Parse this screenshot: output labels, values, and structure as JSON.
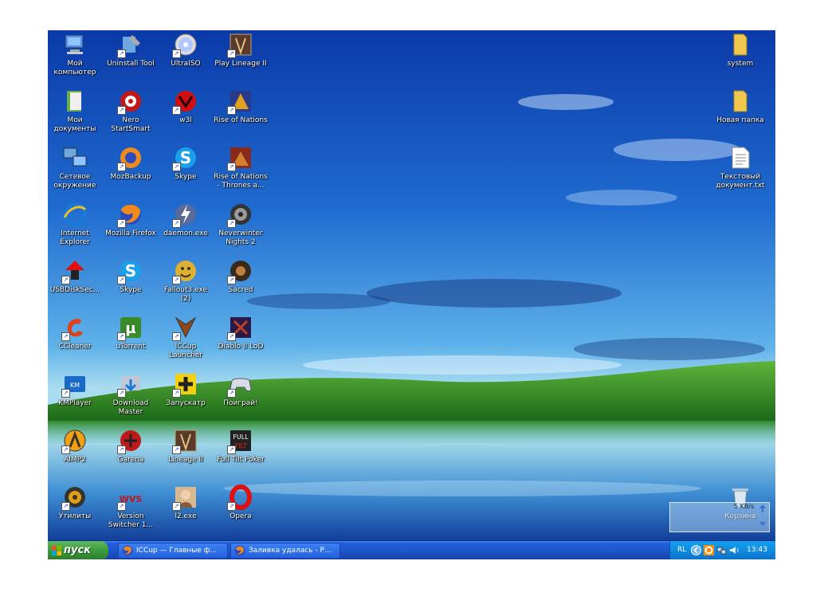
{
  "desktop": {
    "icons": [
      {
        "label": "Мой компьютер",
        "icon": "computer-icon"
      },
      {
        "label": "Uninstall Tool",
        "icon": "uninstall-icon"
      },
      {
        "label": "UltraISO",
        "icon": "disc-icon"
      },
      {
        "label": "Play Lineage II",
        "icon": "lineage-icon"
      },
      {
        "label": "Мои документы",
        "icon": "documents-icon"
      },
      {
        "label": "Nero StartSmart",
        "icon": "nero-icon"
      },
      {
        "label": "w3l",
        "icon": "w3l-icon"
      },
      {
        "label": "Rise of Nations",
        "icon": "rise-of-nations-icon"
      },
      {
        "label": "Сетевое окружение",
        "icon": "network-icon"
      },
      {
        "label": "MozBackup",
        "icon": "mozbackup-icon"
      },
      {
        "label": "Skype",
        "icon": "skype-icon"
      },
      {
        "label": "Rise of Nations - Thrones a...",
        "icon": "thrones-icon"
      },
      {
        "label": "Internet Explorer",
        "icon": "ie-icon"
      },
      {
        "label": "Mozilla Firefox",
        "icon": "firefox-icon"
      },
      {
        "label": "daemon.exe",
        "icon": "daemon-icon"
      },
      {
        "label": "Neverwinter Nights 2",
        "icon": "neverwinter-icon"
      },
      {
        "label": "USBDiskSec...",
        "icon": "usb-icon"
      },
      {
        "label": "Skype",
        "icon": "skype-icon"
      },
      {
        "label": "Fallout3.exe (2)",
        "icon": "fallout-icon"
      },
      {
        "label": "Sacred",
        "icon": "sacred-icon"
      },
      {
        "label": "CCleaner",
        "icon": "ccleaner-icon"
      },
      {
        "label": "uTorrent",
        "icon": "utorrent-icon"
      },
      {
        "label": "ICCup Launcher",
        "icon": "iccup-icon"
      },
      {
        "label": "Diablo II LoD",
        "icon": "diablo-icon"
      },
      {
        "label": "KMPlayer",
        "icon": "kmplayer-icon"
      },
      {
        "label": "Download Master",
        "icon": "download-master-icon"
      },
      {
        "label": "Запускатр",
        "icon": "launcher-icon"
      },
      {
        "label": "Поиграй!",
        "icon": "gamepad-icon"
      },
      {
        "label": "AIMP2",
        "icon": "aimp-icon"
      },
      {
        "label": "Garena",
        "icon": "garena-icon"
      },
      {
        "label": "Lineage II",
        "icon": "lineage-icon"
      },
      {
        "label": "Full Tilt Poker",
        "icon": "poker-icon"
      },
      {
        "label": "Утилиты",
        "icon": "utilities-icon"
      },
      {
        "label": "Version Switcher 1...",
        "icon": "wvs-icon"
      },
      {
        "label": "l2.exe",
        "icon": "l2-icon"
      },
      {
        "label": "Opera",
        "icon": "opera-icon"
      }
    ],
    "right_icons": [
      {
        "label": "system",
        "icon": "folder-icon"
      },
      {
        "label": "Новая папка",
        "icon": "folder-icon"
      },
      {
        "label": "Текстовый документ.txt",
        "icon": "text-file-icon"
      },
      {
        "label": "Корзина",
        "icon": "recycle-bin-icon"
      }
    ],
    "net_speed": "5 KB/s"
  },
  "taskbar": {
    "start_label": "пуск",
    "tasks": [
      {
        "label": "ICCup — Главные ф..."
      },
      {
        "label": "Заливка удалась - Р..."
      }
    ],
    "tray": {
      "lang": "RL",
      "clock": "13:43"
    }
  },
  "colors": {
    "taskbar": "#245edb",
    "start": "#3c9a3c",
    "tray": "#0f8be0"
  }
}
